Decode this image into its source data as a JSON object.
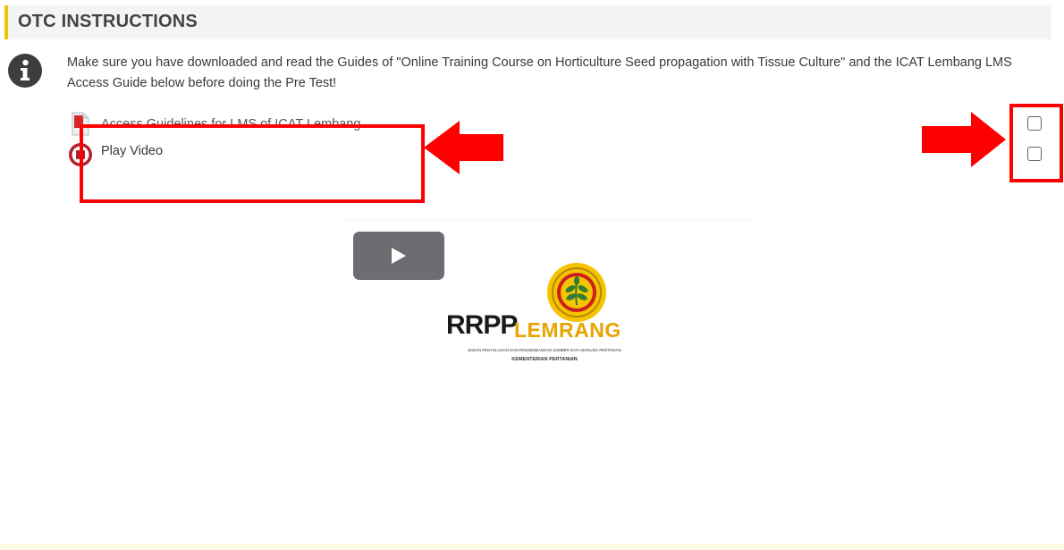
{
  "section": {
    "title": "OTC  INSTRUCTIONS",
    "accent_color": "#f2c200"
  },
  "intro": {
    "icon": "info-icon",
    "text": "Make sure you have downloaded and read the Guides of  \"Online Training Course on Horticulture Seed propagation with Tissue Culture\" and the ICAT Lembang LMS Access Guide below before doing the Pre Test!"
  },
  "activities": [
    {
      "icon": "pdf-icon",
      "label": "Access Guidelines for LMS of ICAT Lembang",
      "completed": false
    },
    {
      "icon": "video-icon",
      "label": "Play Video",
      "completed": false
    }
  ],
  "video": {
    "play_icon": "play-icon",
    "logo": {
      "icon": "bppsdmp-emblem-icon",
      "wordmark_left": "RRPP",
      "wordmark_right": "LEMRANG",
      "subtitle_line1": "BADAN PENYULUHAN DAN PENGEMBANGAN SUMBER DAYA MANUSIA PERTANIAN",
      "subtitle_line2": "KEMENTERIAN PERTANIAN"
    }
  },
  "annotations": {
    "highlight_color": "#ff0000"
  }
}
